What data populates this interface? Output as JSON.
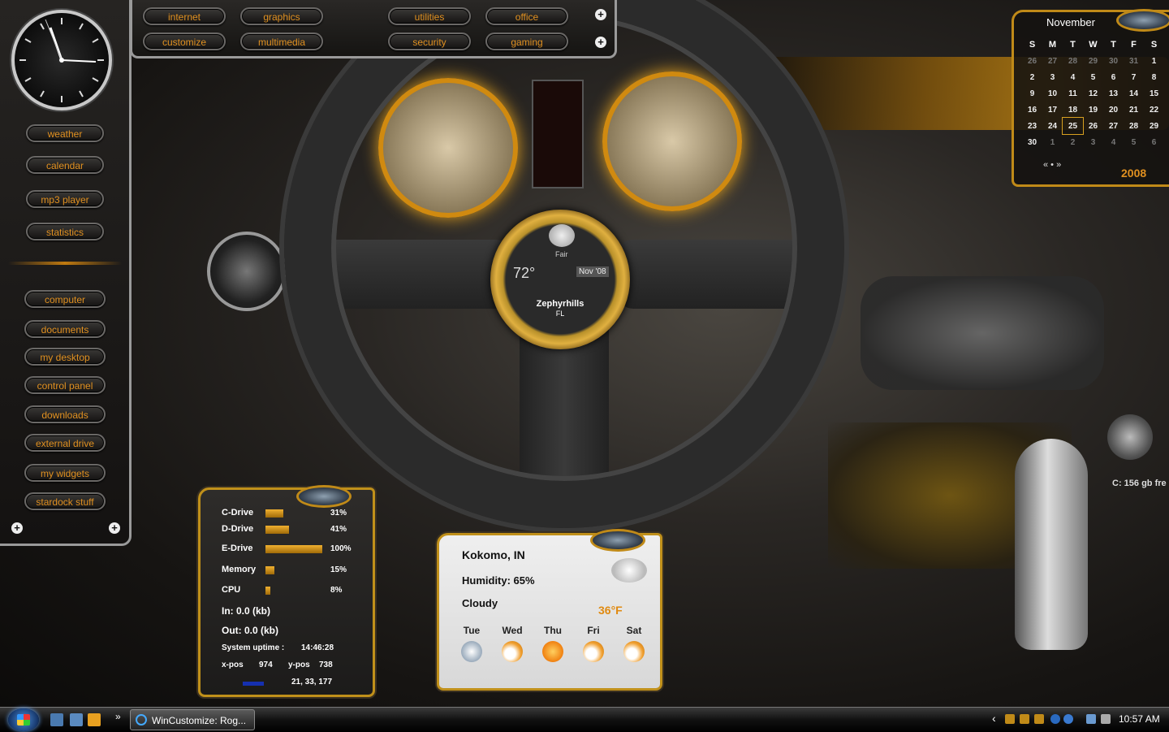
{
  "top_launcher": {
    "row1": [
      "internet",
      "graphics",
      "utilities",
      "office"
    ],
    "row2": [
      "customize",
      "multimedia",
      "security",
      "gaming"
    ]
  },
  "left_menu": {
    "group1": [
      "weather",
      "calendar",
      "mp3 player",
      "statistics"
    ],
    "group2": [
      "computer",
      "documents",
      "my desktop",
      "control panel",
      "downloads",
      "external drive",
      "my widgets",
      "stardock stuff"
    ]
  },
  "calendar": {
    "month": "November",
    "year": "2008",
    "weekdays": [
      "S",
      "M",
      "T",
      "W",
      "T",
      "F",
      "S"
    ],
    "weeks": [
      [
        {
          "d": "26",
          "dim": true
        },
        {
          "d": "27",
          "dim": true
        },
        {
          "d": "28",
          "dim": true
        },
        {
          "d": "29",
          "dim": true
        },
        {
          "d": "30",
          "dim": true
        },
        {
          "d": "31",
          "dim": true
        },
        {
          "d": "1"
        }
      ],
      [
        {
          "d": "2"
        },
        {
          "d": "3"
        },
        {
          "d": "4"
        },
        {
          "d": "5"
        },
        {
          "d": "6"
        },
        {
          "d": "7"
        },
        {
          "d": "8"
        }
      ],
      [
        {
          "d": "9"
        },
        {
          "d": "10"
        },
        {
          "d": "11"
        },
        {
          "d": "12"
        },
        {
          "d": "13"
        },
        {
          "d": "14"
        },
        {
          "d": "15"
        }
      ],
      [
        {
          "d": "16"
        },
        {
          "d": "17"
        },
        {
          "d": "18"
        },
        {
          "d": "19"
        },
        {
          "d": "20"
        },
        {
          "d": "21"
        },
        {
          "d": "22"
        }
      ],
      [
        {
          "d": "23"
        },
        {
          "d": "24"
        },
        {
          "d": "25",
          "today": true
        },
        {
          "d": "26"
        },
        {
          "d": "27"
        },
        {
          "d": "28"
        },
        {
          "d": "29"
        }
      ],
      [
        {
          "d": "30"
        },
        {
          "d": "1",
          "dim": true
        },
        {
          "d": "2",
          "dim": true
        },
        {
          "d": "3",
          "dim": true
        },
        {
          "d": "4",
          "dim": true
        },
        {
          "d": "5",
          "dim": true
        },
        {
          "d": "6",
          "dim": true
        }
      ]
    ],
    "nav": "« • »"
  },
  "sysmon": {
    "drives": [
      {
        "label": "C-Drive",
        "pct": "31%",
        "value": 0.31
      },
      {
        "label": "D-Drive",
        "pct": "41%",
        "value": 0.41
      },
      {
        "label": "E-Drive",
        "pct": "100%",
        "value": 1.0
      },
      {
        "label": "Memory",
        "pct": "15%",
        "value": 0.15
      },
      {
        "label": "CPU",
        "pct": "8%",
        "value": 0.08
      }
    ],
    "net_in": "In: 0.0 (kb)",
    "net_out": "Out: 0.0 (kb)",
    "uptime_label": "System uptime :",
    "uptime_value": "14:46:28",
    "xpos_label": "x-pos",
    "xpos_value": "974",
    "ypos_label": "y-pos",
    "ypos_value": "738",
    "color_value": "21, 33, 177"
  },
  "weather": {
    "location": "Kokomo, IN",
    "humidity": "Humidity: 65%",
    "condition": "Cloudy",
    "temp": "36°F",
    "forecast": [
      {
        "day": "Tue",
        "icon": "snow-icon"
      },
      {
        "day": "Wed",
        "icon": "partly-cloudy-icon"
      },
      {
        "day": "Thu",
        "icon": "sun-icon"
      },
      {
        "day": "Fri",
        "icon": "partly-cloudy-icon"
      },
      {
        "day": "Sat",
        "icon": "partly-cloudy-icon"
      }
    ]
  },
  "gauge_widget": {
    "condition": "Fair",
    "temp": "72°",
    "date": "Nov '08",
    "city": "Zephyrhills",
    "state": "FL"
  },
  "drive_readout": "C: 156 gb fre",
  "taskbar": {
    "task_label": "WinCustomize: Rog...",
    "chevron": "»",
    "tray_arrow": "‹",
    "time": "10:57 AM"
  },
  "colors": {
    "accent": "#e09020",
    "gold": "#c0901a",
    "frame": "#9a9a9a"
  }
}
